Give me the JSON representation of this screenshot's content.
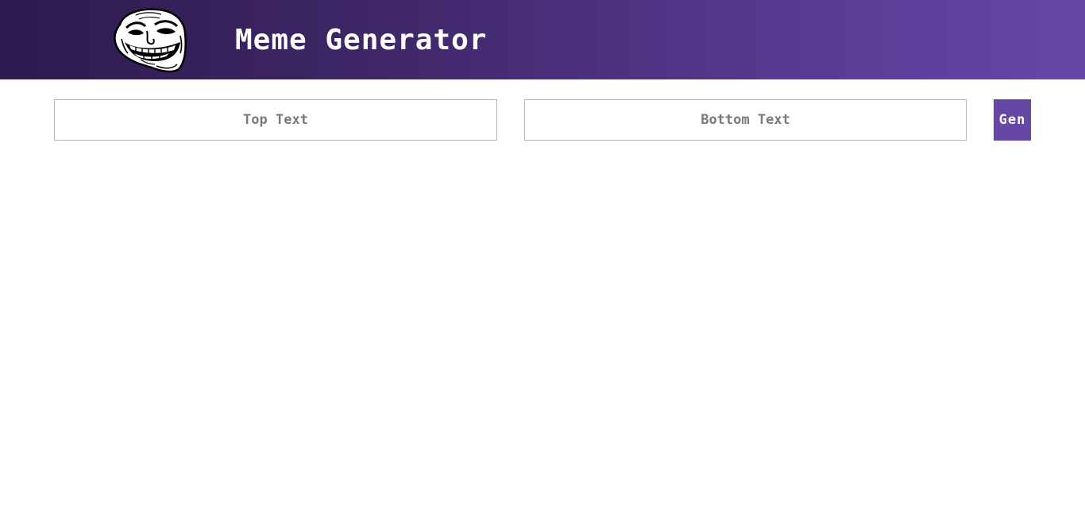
{
  "header": {
    "title": "Meme Generator",
    "logo_icon": "trollface-icon"
  },
  "form": {
    "top_text": {
      "value": "",
      "placeholder": "Top Text"
    },
    "bottom_text": {
      "value": "",
      "placeholder": "Bottom Text"
    },
    "generate_label": "Gen"
  },
  "colors": {
    "header_gradient_start": "#2e1a4d",
    "header_gradient_end": "#6747a6",
    "accent": "#6747a6",
    "input_border": "#b5b5b5",
    "placeholder_text": "#7a7a7a"
  }
}
